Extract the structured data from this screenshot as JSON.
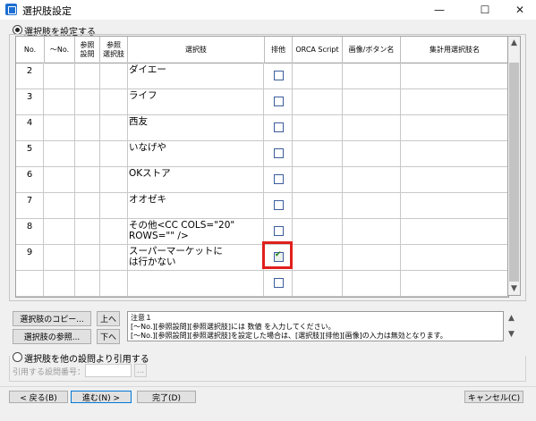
{
  "window": {
    "title": "選択肢設定",
    "minimize": "—",
    "maximize": "☐",
    "close": "✕"
  },
  "option_set": {
    "label": "選択肢を設定する",
    "selected": true
  },
  "grid": {
    "columns": [
      "No.",
      "〜No.",
      "参照\n設問",
      "参照\n選択肢",
      "選択肢",
      "排他",
      "ORCA Script",
      "画像/ボタン名",
      "集計用選択肢名"
    ],
    "rows": [
      {
        "no": "2",
        "text": "ダイエー",
        "exclusive": false
      },
      {
        "no": "3",
        "text": "ライフ",
        "exclusive": false
      },
      {
        "no": "4",
        "text": "西友",
        "exclusive": false
      },
      {
        "no": "5",
        "text": "いなげや",
        "exclusive": false
      },
      {
        "no": "6",
        "text": "OKストア",
        "exclusive": false
      },
      {
        "no": "7",
        "text": "オオゼキ",
        "exclusive": false
      },
      {
        "no": "8",
        "text": "その他<CC COLS=\"20\"\nROWS=\"\" />",
        "exclusive": false
      },
      {
        "no": "9",
        "text": "スーパーマーケットに\nは行かない",
        "exclusive": true
      },
      {
        "no": "",
        "text": "",
        "exclusive": false
      }
    ]
  },
  "buttons": {
    "copy": "選択肢のコピー...",
    "up": "上へ",
    "ref": "選択肢の参照...",
    "down": "下へ",
    "back": "< 戻る(B)",
    "next": "進む(N) >",
    "finish": "完了(D)",
    "cancel": "キャンセル(C)",
    "browse": "..."
  },
  "note": "注意１\n[〜No.][参照設問][参照選択肢]には 数値 を入力してください。\n[〜No.][参照設問][参照選択肢]を設定した場合は、[選択肢][排他][画像]の入力は無効となります。",
  "option_cite": {
    "label": "選択肢を他の設問より引用する",
    "selected": false,
    "field_label": "引用する設問番号：",
    "field_value": ""
  }
}
